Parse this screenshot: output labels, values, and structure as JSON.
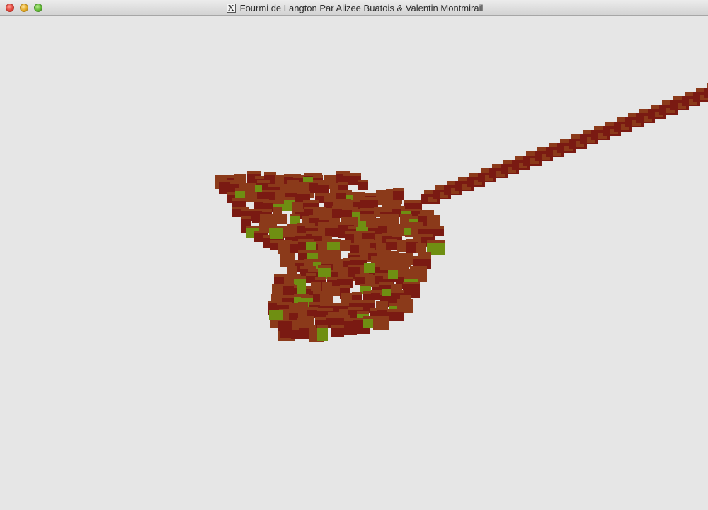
{
  "window": {
    "title": "Fourmi de Langton Par Alizee Buatois & Valentin Montmirail",
    "title_icon": "x11-icon",
    "title_icon_glyph": "X",
    "buttons": [
      "close",
      "minimize",
      "zoom"
    ]
  },
  "scene": {
    "background_color": "#e6e6e6",
    "colors": {
      "dark_red": "#7a1a12",
      "brown": "#8b3a1a",
      "green": "#6f8f12"
    }
  }
}
